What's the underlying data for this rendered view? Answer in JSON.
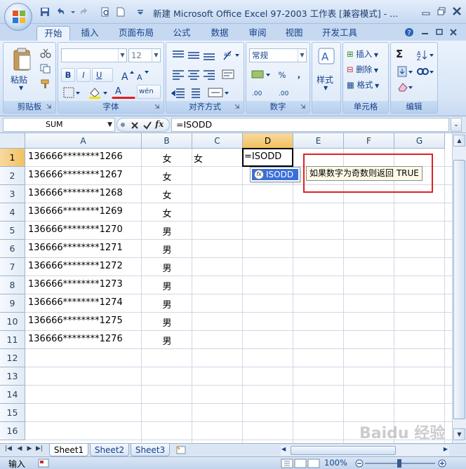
{
  "window": {
    "title": "新建 Microsoft Office Excel 97-2003 工作表  [兼容模式] - ..."
  },
  "ribbon": {
    "tabs": [
      {
        "label": "开始",
        "active": true
      },
      {
        "label": "插入"
      },
      {
        "label": "页面布局"
      },
      {
        "label": "公式"
      },
      {
        "label": "数据"
      },
      {
        "label": "审阅"
      },
      {
        "label": "视图"
      },
      {
        "label": "开发工具"
      }
    ],
    "groups": {
      "clipboard": {
        "label": "剪贴板",
        "paste": "粘贴"
      },
      "font": {
        "label": "字体",
        "font_name": "",
        "font_size": "12",
        "bold": "B",
        "italic": "I",
        "underline": "U",
        "font_color": "A",
        "phonetic": "wén"
      },
      "alignment": {
        "label": "对齐方式"
      },
      "number": {
        "label": "数字",
        "format": "常规",
        "percent": "%",
        "comma": ","
      },
      "styles": {
        "label": "",
        "button": "样式"
      },
      "cells": {
        "label": "单元格",
        "insert": "插入",
        "delete": "删除",
        "format": "格式"
      },
      "editing": {
        "label": "编辑",
        "sum": "Σ"
      }
    }
  },
  "formula_bar": {
    "name_box": "SUM",
    "fx": "fx",
    "formula": "=ISODD"
  },
  "sheet": {
    "columns": [
      "A",
      "B",
      "C",
      "D",
      "E",
      "F",
      "G"
    ],
    "rows": [
      "1",
      "2",
      "3",
      "4",
      "5",
      "6",
      "7",
      "8",
      "9",
      "10",
      "11",
      "12",
      "13",
      "14",
      "15",
      "16"
    ],
    "data": [
      {
        "a": "136666********1266",
        "b": "女",
        "c": "女"
      },
      {
        "a": "136666********1267",
        "b": "女"
      },
      {
        "a": "136666********1268",
        "b": "女"
      },
      {
        "a": "136666********1269",
        "b": "女"
      },
      {
        "a": "136666********1270",
        "b": "男"
      },
      {
        "a": "136666********1271",
        "b": "男"
      },
      {
        "a": "136666********1272",
        "b": "男"
      },
      {
        "a": "136666********1273",
        "b": "男"
      },
      {
        "a": "136666********1274",
        "b": "男"
      },
      {
        "a": "136666********1275",
        "b": "男"
      },
      {
        "a": "136666********1276",
        "b": "男"
      }
    ],
    "active_cell_text": "=ISODD"
  },
  "autocomplete": {
    "item": "ISODD",
    "tooltip": "如果数字为奇数则返回 TRUE"
  },
  "sheet_tabs": [
    "Sheet1",
    "Sheet2",
    "Sheet3"
  ],
  "status": {
    "mode": "输入",
    "zoom": "100%"
  },
  "watermark": "Baidu 经验",
  "colors": {
    "highlight_box": "#e02020",
    "selected_header": "#f1c15f",
    "autocomplete_selected": "#3a6fd8"
  }
}
